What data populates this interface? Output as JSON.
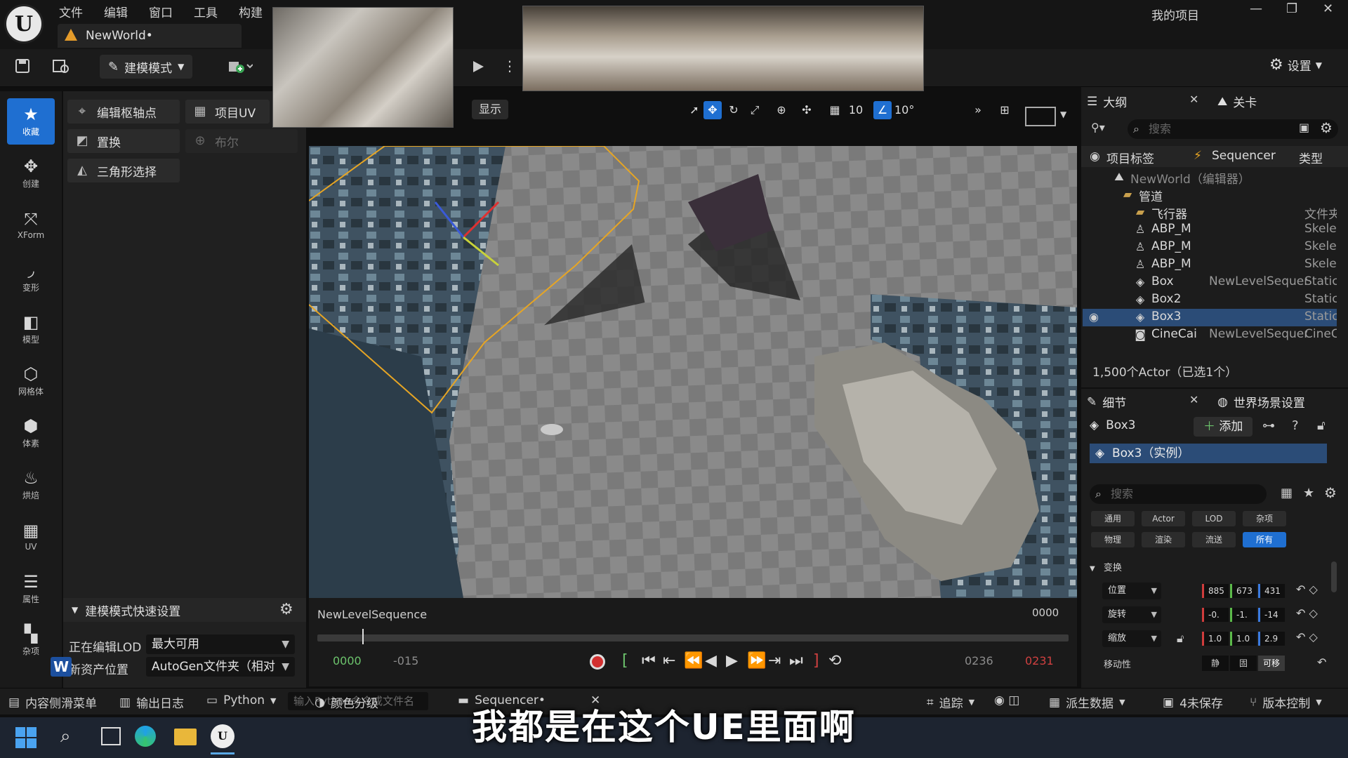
{
  "app": {
    "logo": "U",
    "menu": [
      "文件",
      "编辑",
      "窗口",
      "工具",
      "构建"
    ],
    "doc_tab": "NewWorld•",
    "project_name": "我的项目",
    "window_controls": [
      "—",
      "❐",
      "✕"
    ]
  },
  "toolbar": {
    "mode_label": "建模模式",
    "settings_label": "设置"
  },
  "modebar": [
    {
      "icon": "star-icon",
      "glyph": "★",
      "label": "收藏",
      "active": true
    },
    {
      "icon": "create-icon",
      "glyph": "✥",
      "label": "创建",
      "active": false
    },
    {
      "icon": "xform-icon",
      "glyph": "⤧",
      "label": "XForm",
      "active": false
    },
    {
      "icon": "deform-icon",
      "glyph": "◞",
      "label": "变形",
      "active": false
    },
    {
      "icon": "model-icon",
      "glyph": "◧",
      "label": "模型",
      "active": false
    },
    {
      "icon": "mesh-icon",
      "glyph": "⬡",
      "label": "网格体",
      "active": false
    },
    {
      "icon": "voxel-icon",
      "glyph": "⬢",
      "label": "体素",
      "active": false
    },
    {
      "icon": "bake-icon",
      "glyph": "♨",
      "label": "烘焙",
      "active": false
    },
    {
      "icon": "uv-icon",
      "glyph": "▦",
      "label": "UV",
      "active": false
    },
    {
      "icon": "attributes-icon",
      "glyph": "☰",
      "label": "属性",
      "active": false
    },
    {
      "icon": "misc-icon",
      "glyph": "▚",
      "label": "杂项",
      "active": false
    }
  ],
  "tools": {
    "edit_pivot": "编辑枢轴点",
    "project_uv": "项目UV",
    "replace": "置换",
    "boolean": "布尔",
    "tri_select": "三角形选择"
  },
  "quick_settings": {
    "title": "建模模式快速设置",
    "lod_label": "正在编辑LOD",
    "lod_value": "最大可用",
    "asset_label": "新资产位置",
    "asset_value": "AutoGen文件夹（相对"
  },
  "viewport": {
    "show_label": "显示",
    "grid_snap": "10",
    "rot_snap": "10°"
  },
  "sequencer": {
    "name": "NewLevelSequence",
    "current_time": "0000",
    "start": "0000",
    "start_offset": "-015",
    "end_a": "0236",
    "end_b": "0231",
    "playhead_fraction": 0.06
  },
  "statusbar": {
    "content_drawer": "内容侧滑菜单",
    "output_log": "输出日志",
    "python": "Python",
    "cmd_placeholder": "输入Python命令或文件名",
    "color_grading": "颜色分级",
    "sequencer_tab": "Sequencer•",
    "trace": "追踪",
    "derived_data": "派生数据",
    "unsaved": "4未保存",
    "source_control": "版本控制"
  },
  "subtitle": "我都是在这个UE里面啊",
  "outliner": {
    "tab_outliner": "大纲",
    "tab_levels": "关卡",
    "search_placeholder": "搜索",
    "col_label": "项目标签",
    "col_sequencer": "Sequencer",
    "col_type": "类型",
    "rows": [
      {
        "name": "NewWorld（编辑器）",
        "seq": "",
        "type": "",
        "icon": "world-icon",
        "indent": 68,
        "dim": true
      },
      {
        "name": "管道",
        "seq": "",
        "type": "",
        "icon": "folder-icon",
        "indent": 80,
        "dim": false
      },
      {
        "name": "飞行器",
        "seq": "",
        "type": "文件夹",
        "icon": "folder-icon",
        "indent": 98,
        "dim": false
      },
      {
        "name": "ABP_M",
        "seq": "",
        "type": "Skele",
        "icon": "skeletal-icon",
        "indent": 98,
        "dim": false
      },
      {
        "name": "ABP_M",
        "seq": "",
        "type": "Skele",
        "icon": "skeletal-icon",
        "indent": 98,
        "dim": false
      },
      {
        "name": "ABP_M",
        "seq": "",
        "type": "Skele",
        "icon": "skeletal-icon",
        "indent": 98,
        "dim": false
      },
      {
        "name": "Box",
        "seq": "NewLevelSequer",
        "type": "Static",
        "icon": "static-mesh-icon",
        "indent": 98,
        "dim": false
      },
      {
        "name": "Box2",
        "seq": "",
        "type": "Static",
        "icon": "static-mesh-icon",
        "indent": 98,
        "dim": false
      },
      {
        "name": "Box3",
        "seq": "",
        "type": "Static",
        "icon": "static-mesh-icon",
        "indent": 98,
        "dim": false,
        "selected": true
      },
      {
        "name": "CineCai",
        "seq": "NewLevelSequer",
        "type": "CineC",
        "icon": "camera-icon",
        "indent": 98,
        "dim": false
      }
    ],
    "actor_count": "1,500个Actor（已选1个）"
  },
  "details": {
    "tab_details": "细节",
    "tab_world": "世界场景设置",
    "object_name": "Box3",
    "add_label": "添加",
    "instance_label": "Box3（实例）",
    "search_placeholder": "搜索",
    "filters_row1": [
      "通用",
      "Actor",
      "LOD",
      "杂项"
    ],
    "filters_row2": [
      "物理",
      "渲染",
      "流送",
      "所有"
    ],
    "transform_header": "变换",
    "location_label": "位置",
    "location": [
      "885",
      "673",
      "431"
    ],
    "rotation_label": "旋转",
    "rotation": [
      "-0.",
      "-1.",
      "-14"
    ],
    "scale_label": "缩放",
    "scale": [
      "1.0",
      "1.0",
      "2.9"
    ],
    "mobility_label": "移动性",
    "mobility": [
      "静",
      "固",
      "可移"
    ]
  }
}
